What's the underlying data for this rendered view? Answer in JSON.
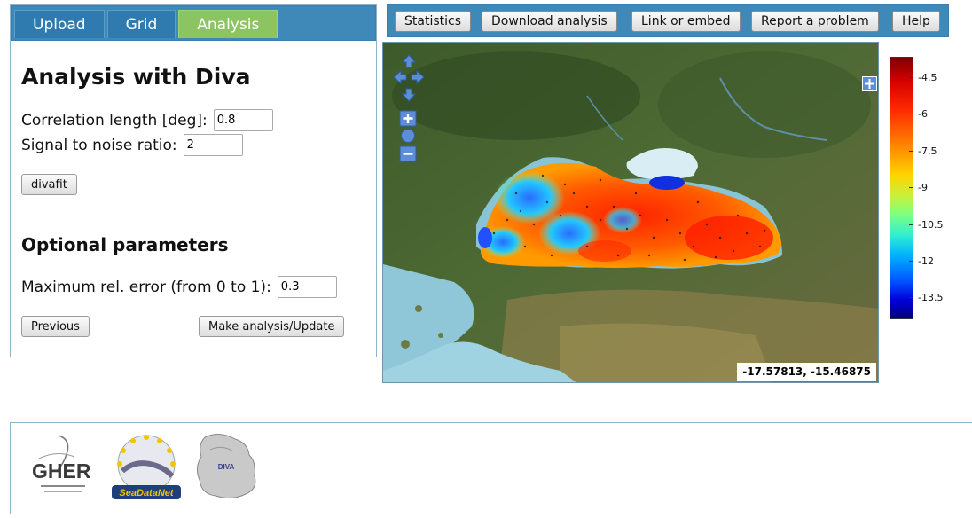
{
  "tabs": [
    {
      "label": "Upload",
      "active": false
    },
    {
      "label": "Grid",
      "active": false
    },
    {
      "label": "Analysis",
      "active": true
    }
  ],
  "panel": {
    "title": "Analysis with Diva",
    "correlation_label": "Correlation length [deg]:",
    "correlation_value": "0.8",
    "snr_label": "Signal to noise ratio:",
    "snr_value": "2",
    "divafit_label": "divafit",
    "optional_title": "Optional parameters",
    "max_error_label": "Maximum rel. error (from 0 to 1):",
    "max_error_value": "0.3",
    "previous_label": "Previous",
    "make_analysis_label": "Make analysis/Update"
  },
  "toolbar": {
    "buttons": [
      "Statistics",
      "Download analysis",
      "Link or embed",
      "Report a problem",
      "Help"
    ]
  },
  "map": {
    "coordinates": "-17.57813, -15.46875",
    "pan_icons": [
      "pan-up-icon",
      "pan-left-icon",
      "pan-right-icon",
      "pan-down-icon"
    ],
    "zoom_icons": [
      "zoom-in-icon",
      "zoom-world-icon",
      "zoom-out-icon"
    ],
    "layer_switcher_icon": "layer-switcher-icon"
  },
  "colorbar": {
    "ticks": [
      "-4.5",
      "-6",
      "-7.5",
      "-9",
      "-10.5",
      "-12",
      "-13.5"
    ],
    "colors": {
      "max": "#7f0000",
      "mid": "#7fff7f",
      "min": "#00007f"
    }
  },
  "footer": {
    "logos": [
      {
        "name": "gher-logo",
        "text": "GHER"
      },
      {
        "name": "seadatanet-logo",
        "text": "SeaDataNet"
      },
      {
        "name": "diva-logo",
        "text": "DIVA"
      }
    ]
  },
  "colors": {
    "tab_bar": "#3f89b9",
    "tab_active": "#8cc462"
  }
}
